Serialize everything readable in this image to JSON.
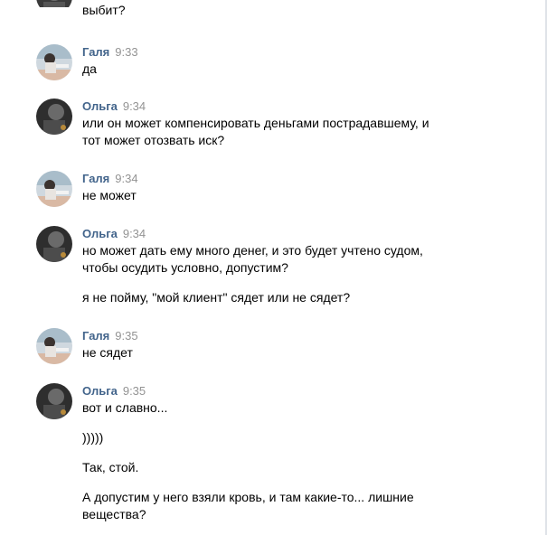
{
  "messages": [
    {
      "author": "",
      "time": "",
      "avatar": "olga-avatar",
      "paragraphs": [
        [
          "выбит?"
        ]
      ]
    },
    {
      "author": "Галя",
      "time": "9:33",
      "avatar": "galya-avatar",
      "paragraphs": [
        [
          "да"
        ]
      ]
    },
    {
      "author": "Ольга",
      "time": "9:34",
      "avatar": "olga-avatar",
      "paragraphs": [
        [
          "или он может компенсировать деньгами пострадавшему, и",
          "тот может отозвать иск?"
        ]
      ]
    },
    {
      "author": "Галя",
      "time": "9:34",
      "avatar": "galya-avatar",
      "paragraphs": [
        [
          "не может"
        ]
      ]
    },
    {
      "author": "Ольга",
      "time": "9:34",
      "avatar": "olga-avatar",
      "paragraphs": [
        [
          "но может дать ему много денег, и это будет учтено судом,",
          "чтобы осудить условно, допустим?"
        ],
        [
          "я не пойму, \"мой клиент\" сядет или не сядет?"
        ]
      ]
    },
    {
      "author": "Галя",
      "time": "9:35",
      "avatar": "galya-avatar",
      "paragraphs": [
        [
          "не сядет"
        ]
      ]
    },
    {
      "author": "Ольга",
      "time": "9:35",
      "avatar": "olga-avatar",
      "paragraphs": [
        [
          "вот и славно..."
        ],
        [
          ")))))"
        ],
        [
          "Так, стой."
        ],
        [
          "А допустим у него взяли кровь, и там какие-то... лишние",
          "вещества?"
        ]
      ]
    }
  ],
  "colors": {
    "author": "#42648b",
    "time": "#939393",
    "text": "#000000",
    "border": "#dfe3e8"
  }
}
